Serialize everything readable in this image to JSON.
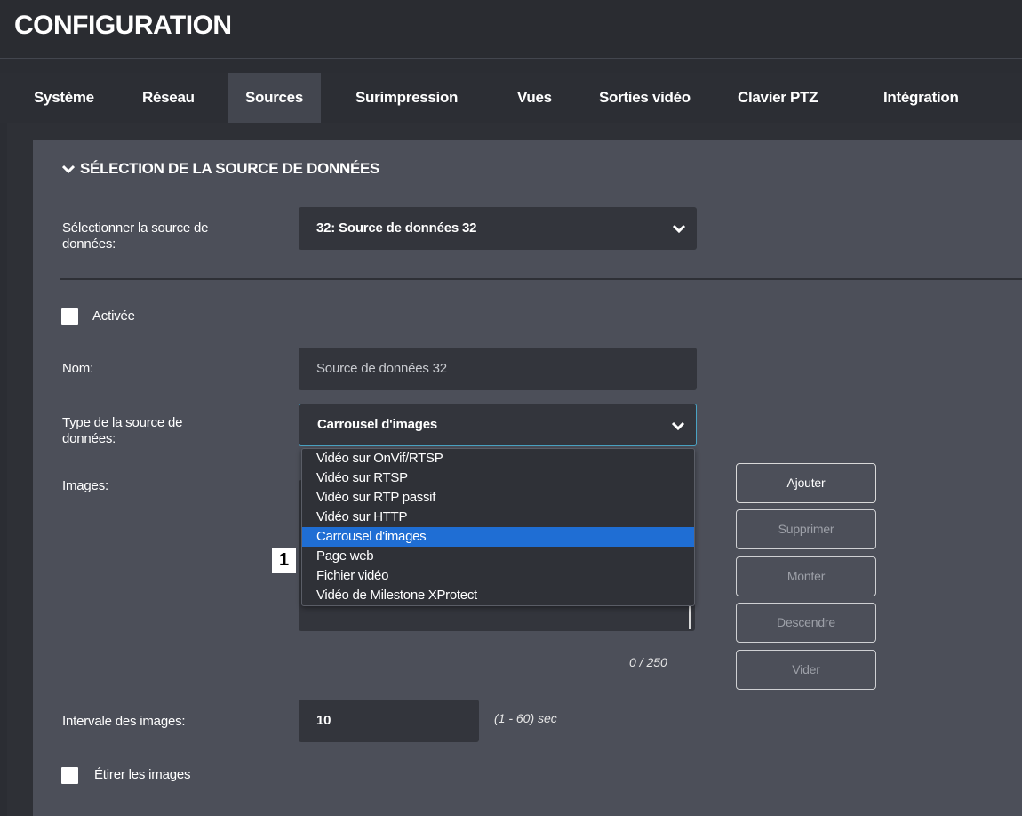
{
  "header": {
    "title": "CONFIGURATION"
  },
  "tabs": [
    {
      "label": "Système"
    },
    {
      "label": "Réseau"
    },
    {
      "label": "Sources"
    },
    {
      "label": "Surimpression"
    },
    {
      "label": "Vues"
    },
    {
      "label": "Sorties vidéo"
    },
    {
      "label": "Clavier PTZ"
    },
    {
      "label": "Intégration"
    }
  ],
  "active_tab": "Sources",
  "section": {
    "title": "SÉLECTION DE LA SOURCE DE DONNÉES"
  },
  "form": {
    "source_select": {
      "label_line1": "Sélectionner la source de",
      "label_line2": "données:",
      "value": "32: Source de données 32"
    },
    "enabled": {
      "label": "Activée",
      "checked": false
    },
    "name": {
      "label": "Nom:",
      "value": "Source de données 32"
    },
    "type": {
      "label_line1": "Type de la source de",
      "label_line2": "données:",
      "value": "Carrousel d'images"
    },
    "images": {
      "label": "Images:",
      "counter": "0 / 250"
    },
    "interval": {
      "label": "Intervale des images:",
      "value": "10",
      "hint": "(1 - 60) sec"
    },
    "stretch": {
      "label": "Étirer les images",
      "checked": false
    }
  },
  "dropdown": {
    "options": [
      "Vidéo sur OnVif/RTSP",
      "Vidéo sur RTSP",
      "Vidéo sur RTP passif",
      "Vidéo sur HTTP",
      "Carrousel d'images",
      "Page web",
      "Fichier vidéo",
      "Vidéo de Milestone XProtect"
    ],
    "selected_index": 4
  },
  "callout": {
    "number": "1"
  },
  "buttons": {
    "add": "Ajouter",
    "remove": "Supprimer",
    "up": "Monter",
    "down": "Descendre",
    "clear": "Vider"
  },
  "colors": {
    "accent": "#1f6ed4",
    "focus": "#4aa3c4",
    "card": "#4c4f59",
    "field": "#33353c"
  },
  "icons": {
    "section_toggle": "chevron-down-icon",
    "select_caret": "chevron-down-icon"
  }
}
